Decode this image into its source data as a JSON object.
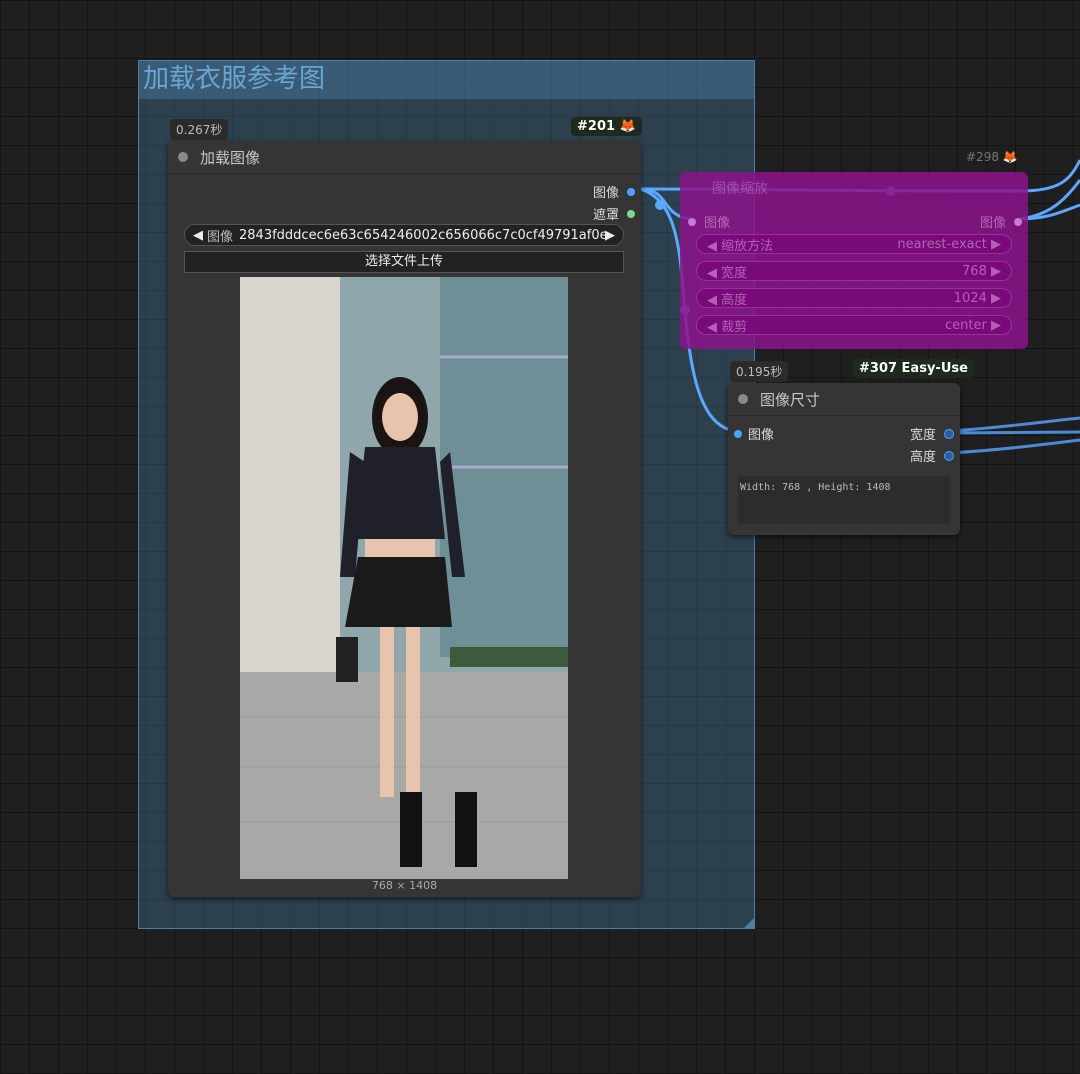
{
  "group": {
    "title": "加载衣服参考图"
  },
  "load_node": {
    "timing": "0.267秒",
    "badge_id": "#201",
    "badge_icon": "fox-icon",
    "title": "加载图像",
    "outputs": [
      {
        "label": "图像",
        "color": "#4aa3ff"
      },
      {
        "label": "遮罩",
        "color": "#7bd88f"
      }
    ],
    "image_widget": {
      "label": "图像",
      "value": "2843fdddcec6e63c654246002c656066c7c0cf49791af0e..."
    },
    "upload_button": "选择文件上传",
    "image_size": "768 × 1408"
  },
  "resize_node": {
    "badge_id": "#298",
    "title": "图像缩放",
    "input": "图像",
    "output": "图像",
    "widgets": [
      {
        "label": "缩放方法",
        "value": "nearest-exact"
      },
      {
        "label": "宽度",
        "value": "768"
      },
      {
        "label": "高度",
        "value": "1024"
      },
      {
        "label": "裁剪",
        "value": "center"
      }
    ]
  },
  "size_node": {
    "timing": "0.195秒",
    "badge": "#307 Easy-Use",
    "title": "图像尺寸",
    "input": "图像",
    "outputs": [
      "宽度",
      "高度"
    ],
    "text": "Width: 768 , Height: 1408"
  },
  "colors": {
    "link": "#5aa8ff",
    "group": "#4a7fa8",
    "purple": "#8c148c"
  }
}
